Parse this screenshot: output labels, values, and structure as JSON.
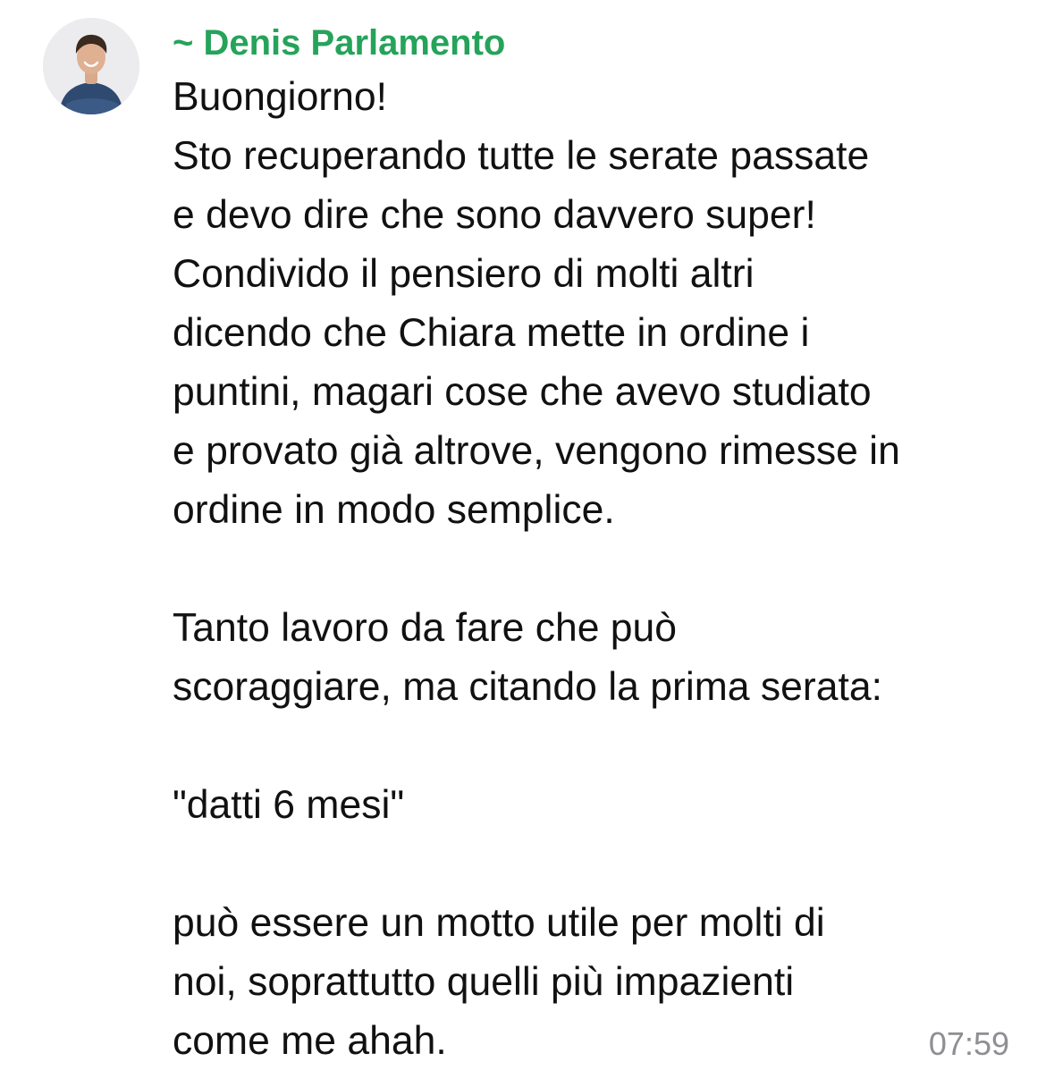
{
  "message": {
    "sender": "~ Denis Parlamento",
    "sender_color": "#25a35a",
    "avatar": "profile-photo",
    "lines": [
      "Buongiorno!",
      "Sto recuperando tutte le serate passate",
      "e devo dire che sono davvero super!",
      "Condivido il pensiero di molti altri",
      "dicendo che Chiara mette in ordine i",
      "puntini, magari cose che avevo studiato",
      "e provato già altrove, vengono rimesse in",
      "ordine in modo semplice.",
      "",
      "Tanto lavoro da fare che può",
      "scoraggiare, ma citando la prima serata:",
      "",
      "\"datti 6 mesi\"",
      "",
      "può essere un motto utile per molti di",
      "noi, soprattutto quelli più impazienti",
      "come me ahah."
    ],
    "time": "07:59"
  }
}
